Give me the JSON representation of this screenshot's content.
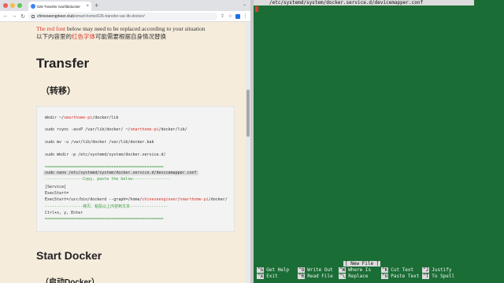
{
  "browser": {
    "tab": {
      "title": "026-Transfer /var/lib/docker",
      "close": "×"
    },
    "new_tab": "+",
    "tab_menu": "⌄",
    "nav": {
      "back": "←",
      "forward": "→",
      "reload": "↻"
    },
    "address": {
      "domain": "chineseengineer.club",
      "path": "/smart-home/026-transfer-var-lib-docker/"
    },
    "toolbar_icons": {
      "share": "⇪",
      "bookmark": "☆",
      "menu": "⋮"
    }
  },
  "page": {
    "note_en_red": "The red font",
    "note_en_rest": " below may need to be replaced according to your situation",
    "note_cn_before": "以下内容里的",
    "note_cn_red": "红色字体",
    "note_cn_after": "可能需要根据自身情况替换",
    "heading_transfer": "Transfer",
    "heading_transfer_cn": "（转移）",
    "code": {
      "line1_before": "mkdir ~/",
      "line1_red": "smarthome-pi",
      "line1_after": "/docker/lib",
      "line2_before": "sudo rsync -avxP /var/lib/docker/ ~/",
      "line2_red": "smarthome-pi",
      "line2_after": "/docker/lib/",
      "line3": "sudo mv -u /var/lib/docker /var/lib/docker.bak",
      "line4": "sudo mkdir -p /etc/systemd/system/docker.service.d/",
      "separator1": "==================================================",
      "line5": "sudo nano /etc/systemd/system/docker.service.d/devicemapper.conf",
      "copy_note": "----------------Copy, paste the below----------------",
      "line6": "[Service]",
      "line7": "ExecStart=",
      "line8_before": "ExecStart=/usr/bin/dockerd --graph=/home/",
      "line8_red1": "chineseengineer",
      "line8_mid": "/",
      "line8_red2": "smarthome-pi",
      "line8_after": "/docker/",
      "copy_note_cn": "----------------拷贝、粘贴以上内容到文本----------------",
      "line9": "Ctrl+x, y, Enter",
      "separator2": "=================================================="
    },
    "heading_docker": "Start Docker",
    "heading_docker_cn": "（启动Docker）"
  },
  "terminal": {
    "title": "/etc/systemd/system/docker.service.d/devicemapper.conf",
    "status": "[ New File ]",
    "shortcuts": [
      {
        "key": "^G",
        "label": "Get Help"
      },
      {
        "key": "^O",
        "label": "Write Out"
      },
      {
        "key": "^W",
        "label": "Where Is"
      },
      {
        "key": "^K",
        "label": "Cut Text"
      },
      {
        "key": "^J",
        "label": "Justify"
      },
      {
        "key": "^X",
        "label": "Exit"
      },
      {
        "key": "^R",
        "label": "Read File"
      },
      {
        "key": "^\\",
        "label": "Replace"
      },
      {
        "key": "^U",
        "label": "Paste Text"
      },
      {
        "key": "^T",
        "label": "To Spell"
      }
    ]
  },
  "colors": {
    "terminal_bg": "#1b6d36",
    "page_bg": "#f5ecdc",
    "accent_red": "#d9362b",
    "code_green": "#3a9e3a"
  }
}
